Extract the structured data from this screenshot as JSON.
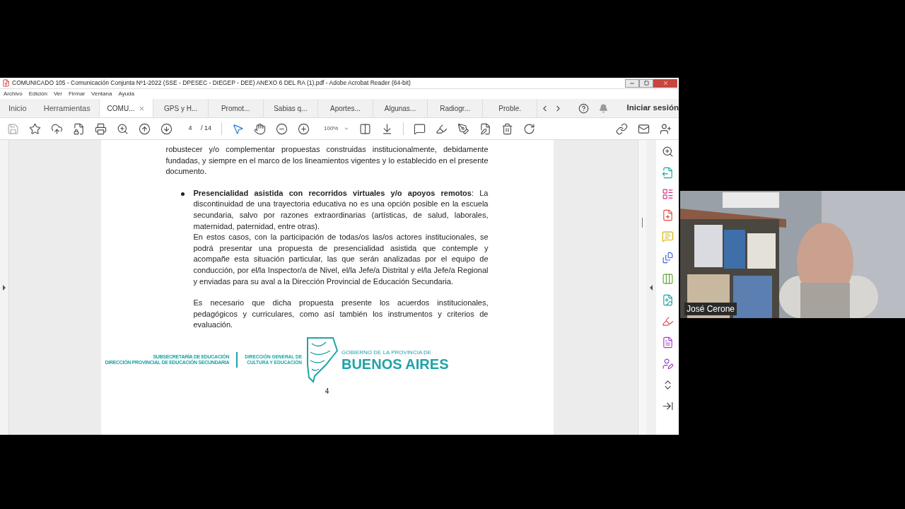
{
  "window": {
    "title": "COMUNICADO 105 - Comunicación Conjunta Nº1-2022 (SSE - DPESEC - DIEGEP - DEE) ANEXO 6 DEL RA (1).pdf - Adobe Acrobat Reader (64-bit)"
  },
  "menu": [
    "Archivo",
    "Edición",
    "Ver",
    "Firmar",
    "Ventana",
    "Ayuda"
  ],
  "tabs": [
    {
      "label": "Inicio",
      "kind": "home",
      "selected": false
    },
    {
      "label": "Herramientas",
      "kind": "home",
      "selected": false
    },
    {
      "label": "COMU...",
      "kind": "doc",
      "selected": true
    },
    {
      "label": "GPS y H...",
      "kind": "doc",
      "selected": false
    },
    {
      "label": "Promot...",
      "kind": "doc",
      "selected": false
    },
    {
      "label": "Sabias q...",
      "kind": "doc",
      "selected": false
    },
    {
      "label": "Aportes...",
      "kind": "doc",
      "selected": false
    },
    {
      "label": "Algunas...",
      "kind": "doc",
      "selected": false
    },
    {
      "label": "Radiogr...",
      "kind": "doc",
      "selected": false
    },
    {
      "label": "Proble.",
      "kind": "doc",
      "selected": false
    }
  ],
  "sign_in": "Iniciar sesión",
  "toolbar": {
    "page": "4",
    "page_total": "/ 14",
    "zoom": "100%"
  },
  "document": {
    "paragraphs": [
      {
        "kind": "plain",
        "text": "robustecer y/o complementar propuestas construidas institucionalmente, debidamente fundadas, y siempre en el marco de los lineamientos vigentes y lo establecido en el presente documento."
      },
      {
        "kind": "bullet",
        "text": "**Presencialidad asistida con recorridos virtuales y/o apoyos remotos**: La discontinuidad de una trayectoria educativa no es una opción posible en la escuela secundaria, salvo por razones extraordinarias (artísticas, de salud, laborales, maternidad, paternidad, entre otras)."
      },
      {
        "kind": "indented",
        "text": "En estos casos, con la participación de todas/os las/os actores institucionales, se podrá presentar una propuesta de presencialidad asistida que contemple y acompañe esta situación particular, las que serán analizadas por el equipo de conducción, por el/la Inspector/a de Nivel, el/la Jefe/a Distrital y el/la Jefe/a Regional y enviadas para su aval a la Dirección Provincial de Educación Secundaria."
      },
      {
        "kind": "indented_gap",
        "text": "Es necesario que dicha propuesta presente los acuerdos institucionales, pedagógicos y curriculares, como así también los instrumentos y criterios de evaluación."
      }
    ],
    "footer": {
      "left": [
        "SUBSECRETARÍA DE EDUCACIÓN",
        "DIRECCIÓN PROVINCIAL DE EDUCACIÓN SECUNDARIA"
      ],
      "middle": [
        "DIRECCIÓN GENERAL DE",
        "CULTURA Y EDUCACIÓN"
      ],
      "gov_line": "GOBIERNO DE LA PROVINCIA DE",
      "province": "BUENOS AIRES"
    },
    "page_number": "4"
  },
  "video": {
    "name": "José Cerone"
  }
}
